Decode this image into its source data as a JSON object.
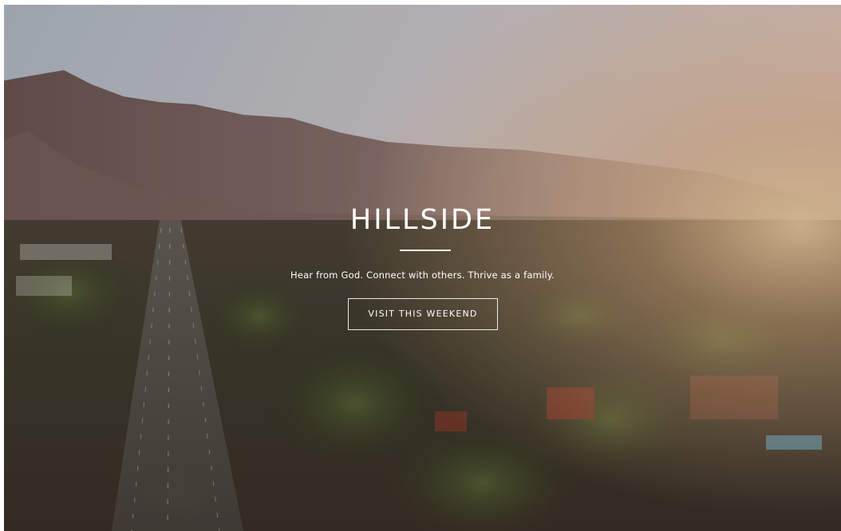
{
  "hero": {
    "brand": "HILLSIDE",
    "tagline": "Hear from God. Connect with others. Thrive as a family.",
    "cta_label": "VISIT THIS WEEKEND"
  },
  "colors": {
    "text": "#ffffff",
    "sky_top": "#bfc8d4",
    "sunset_glow": "#f3cfa6",
    "forest": "#3f3a2c"
  }
}
